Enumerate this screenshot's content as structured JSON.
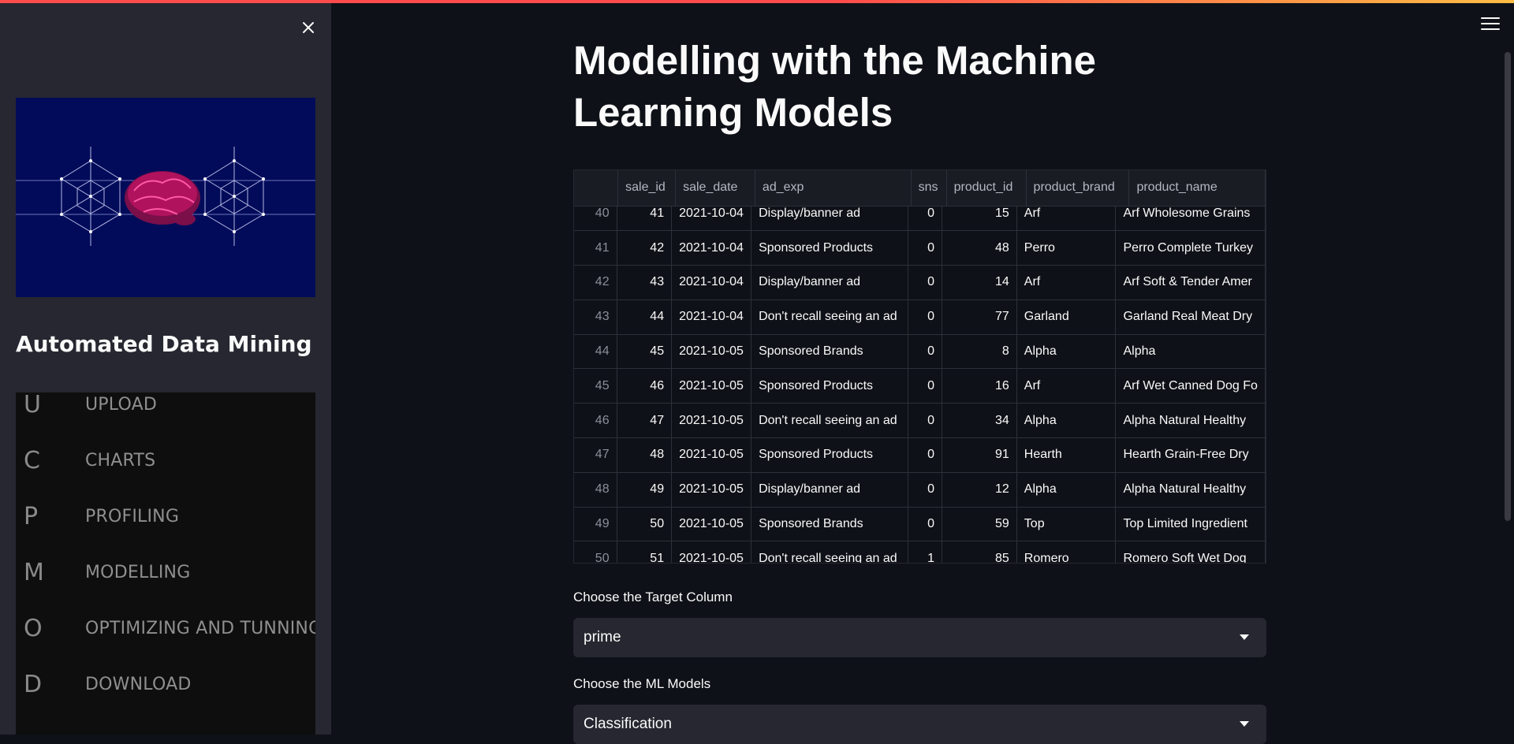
{
  "sidebar": {
    "title": "Automated Data Mining",
    "menu": [
      {
        "letter": "U",
        "label": "UPLOAD"
      },
      {
        "letter": "C",
        "label": "CHARTS"
      },
      {
        "letter": "P",
        "label": "PROFILING"
      },
      {
        "letter": "M",
        "label": "MODELLING"
      },
      {
        "letter": "O",
        "label": "OPTIMIZING AND TUNNING"
      },
      {
        "letter": "D",
        "label": "DOWNLOAD"
      }
    ]
  },
  "main": {
    "title": "Modelling with the Machine Learning Models",
    "table": {
      "columns": [
        "",
        "sale_id",
        "sale_date",
        "ad_exp",
        "sns",
        "product_id",
        "product_brand",
        "product_name"
      ],
      "rows": [
        [
          "40",
          "41",
          "2021-10-04",
          "Display/banner ad",
          "0",
          "15",
          "Arf",
          "Arf Wholesome Grains"
        ],
        [
          "41",
          "42",
          "2021-10-04",
          "Sponsored Products",
          "0",
          "48",
          "Perro",
          "Perro Complete Turkey"
        ],
        [
          "42",
          "43",
          "2021-10-04",
          "Display/banner ad",
          "0",
          "14",
          "Arf",
          "Arf Soft & Tender Amer"
        ],
        [
          "43",
          "44",
          "2021-10-04",
          "Don't recall seeing an ad",
          "0",
          "77",
          "Garland",
          "Garland Real Meat Dry"
        ],
        [
          "44",
          "45",
          "2021-10-05",
          "Sponsored Brands",
          "0",
          "8",
          "Alpha",
          "Alpha"
        ],
        [
          "45",
          "46",
          "2021-10-05",
          "Sponsored Products",
          "0",
          "16",
          "Arf",
          "Arf Wet Canned Dog Fo"
        ],
        [
          "46",
          "47",
          "2021-10-05",
          "Don't recall seeing an ad",
          "0",
          "34",
          "Alpha",
          "Alpha Natural Healthy"
        ],
        [
          "47",
          "48",
          "2021-10-05",
          "Sponsored Products",
          "0",
          "91",
          "Hearth",
          "Hearth Grain-Free Dry"
        ],
        [
          "48",
          "49",
          "2021-10-05",
          "Display/banner ad",
          "0",
          "12",
          "Alpha",
          "Alpha Natural Healthy"
        ],
        [
          "49",
          "50",
          "2021-10-05",
          "Sponsored Brands",
          "0",
          "59",
          "Top",
          "Top Limited Ingredient"
        ],
        [
          "50",
          "51",
          "2021-10-05",
          "Don't recall seeing an ad",
          "1",
          "85",
          "Romero",
          "Romero Soft Wet Dog"
        ]
      ]
    },
    "target": {
      "label": "Choose the Target Column",
      "value": "prime"
    },
    "models": {
      "label": "Choose the ML Models",
      "value": "Classification"
    }
  },
  "colors": {
    "accent": "#ff4b4b",
    "accent2": "#ffbd45",
    "sidebar_bg": "#262730",
    "main_bg": "#0e1117"
  }
}
